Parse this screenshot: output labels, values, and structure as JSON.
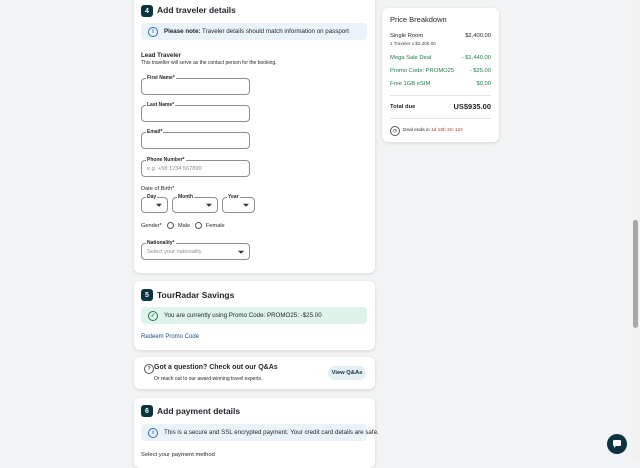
{
  "traveler": {
    "step": "4",
    "title": "Add traveler details",
    "note_bold": "Please note:",
    "note_text": " Traveler details should match information on passport",
    "lead_title": "Lead Traveler",
    "lead_sub": "This traveller will serve as the contact person for the booking.",
    "first_name_label": "First Name*",
    "last_name_label": "Last Name*",
    "email_label": "Email*",
    "phone_label": "Phone Number*",
    "phone_placeholder": "e.g. +58 1234 567890",
    "dob_label": "Date of Birth*",
    "day_label": "Day",
    "month_label": "Month",
    "year_label": "Year",
    "gender_label": "Gender*",
    "gender_male": "Male",
    "gender_female": "Female",
    "nationality_label": "Nationality*",
    "nationality_placeholder": "Select your nationality"
  },
  "savings": {
    "step": "5",
    "title": "TourRadar Savings",
    "promo_text": "You are currently using Promo Code: PROMO25: -$25.00",
    "redeem_link": "Redeem Promo Code"
  },
  "qa": {
    "title": "Got a question? Check out our Q&As",
    "sub": "Or reach out to our award-winning travel experts.",
    "button": "View Q&As"
  },
  "payment": {
    "step": "6",
    "title": "Add payment details",
    "secure_text": "This is a secure and SSL encrypted payment. Your credit card details are safe.",
    "select_method": "Select your payment method"
  },
  "price": {
    "title": "Price Breakdown",
    "room_label": "Single Room",
    "room_amount": "$2,400.00",
    "room_sub": "1 Traveler x $2,400.00",
    "deal_label": "Mega Sale Deal",
    "deal_amount": "- $1,440.00",
    "promo_label": "Promo Code: PROMO25",
    "promo_amount": "- $25.00",
    "esim_label": "Free 1GB eSIM",
    "esim_amount": "$0.00",
    "total_label": "Total due",
    "total_amount": "US$935.00",
    "deal_ends_prefix": "Deal ends in ",
    "deal_ends_time": "1d 18h 3m 12s"
  },
  "colors": {
    "accent_dark": "#0b3340",
    "green": "#1f7a4a",
    "link_blue": "#1d4f91",
    "countdown_red": "#c0392b"
  },
  "icons": [
    "info-icon",
    "check-circle-icon",
    "question-circle-icon",
    "clock-icon",
    "chat-icon",
    "chevron-down-icon"
  ]
}
